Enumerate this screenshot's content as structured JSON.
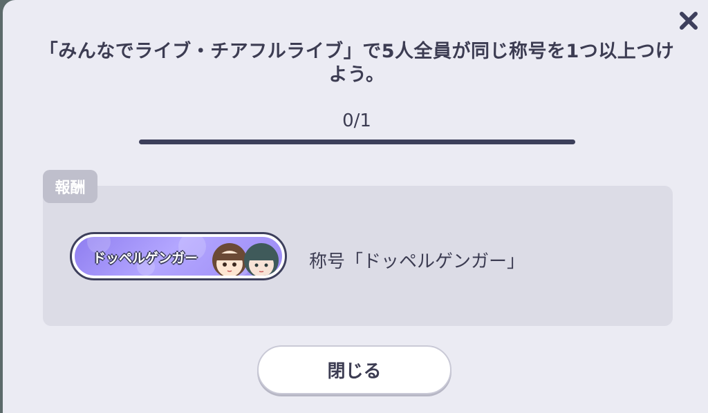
{
  "dialog": {
    "message": "「みんなでライブ・チアフルライブ」で5人全員が同じ称号を1つ以上つけよう。",
    "progress_text": "0/1",
    "progress_fraction": 0,
    "close_icon": "close-x-icon"
  },
  "reward": {
    "section_label": "報酬",
    "badge_text": "ドッペルゲンガー",
    "reward_name": "称号「ドッペルゲンガー」"
  },
  "footer": {
    "close_label": "閉じる"
  },
  "colors": {
    "text": "#3c3c52",
    "progress_track": "#3c3f5a",
    "badge_gradient_start": "#8f7ef0",
    "badge_gradient_end": "#b3a6ff",
    "panel": "#dcdce6"
  }
}
